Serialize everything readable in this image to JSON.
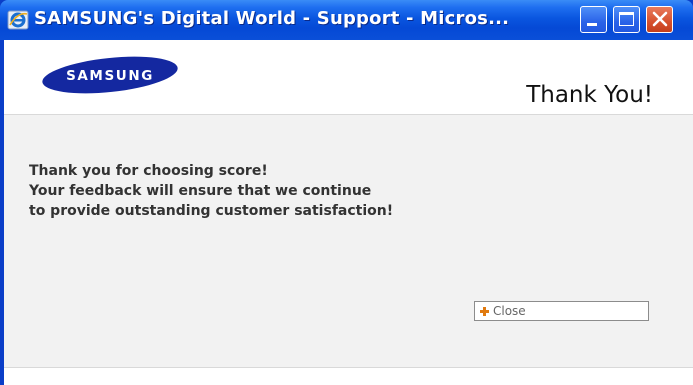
{
  "window": {
    "title": "SAMSUNG's Digital World - Support - Micros...",
    "icon": "internet-explorer-icon",
    "controls": {
      "minimize": "minimize-icon",
      "maximize": "maximize-icon",
      "close": "close-icon"
    }
  },
  "header": {
    "logo_text": "SAMSUNG",
    "heading": "Thank You!"
  },
  "message": {
    "lines": [
      "Thank you for choosing score!",
      "Your feedback will ensure that we continue",
      "to provide outstanding customer satisfaction!"
    ]
  },
  "close_button": {
    "label": "Close",
    "icon": "plus-icon",
    "icon_color": "#e07a10"
  },
  "colors": {
    "titlebar": "#0a56e0",
    "logo": "#1428a0",
    "body_background": "#f2f2f2"
  }
}
